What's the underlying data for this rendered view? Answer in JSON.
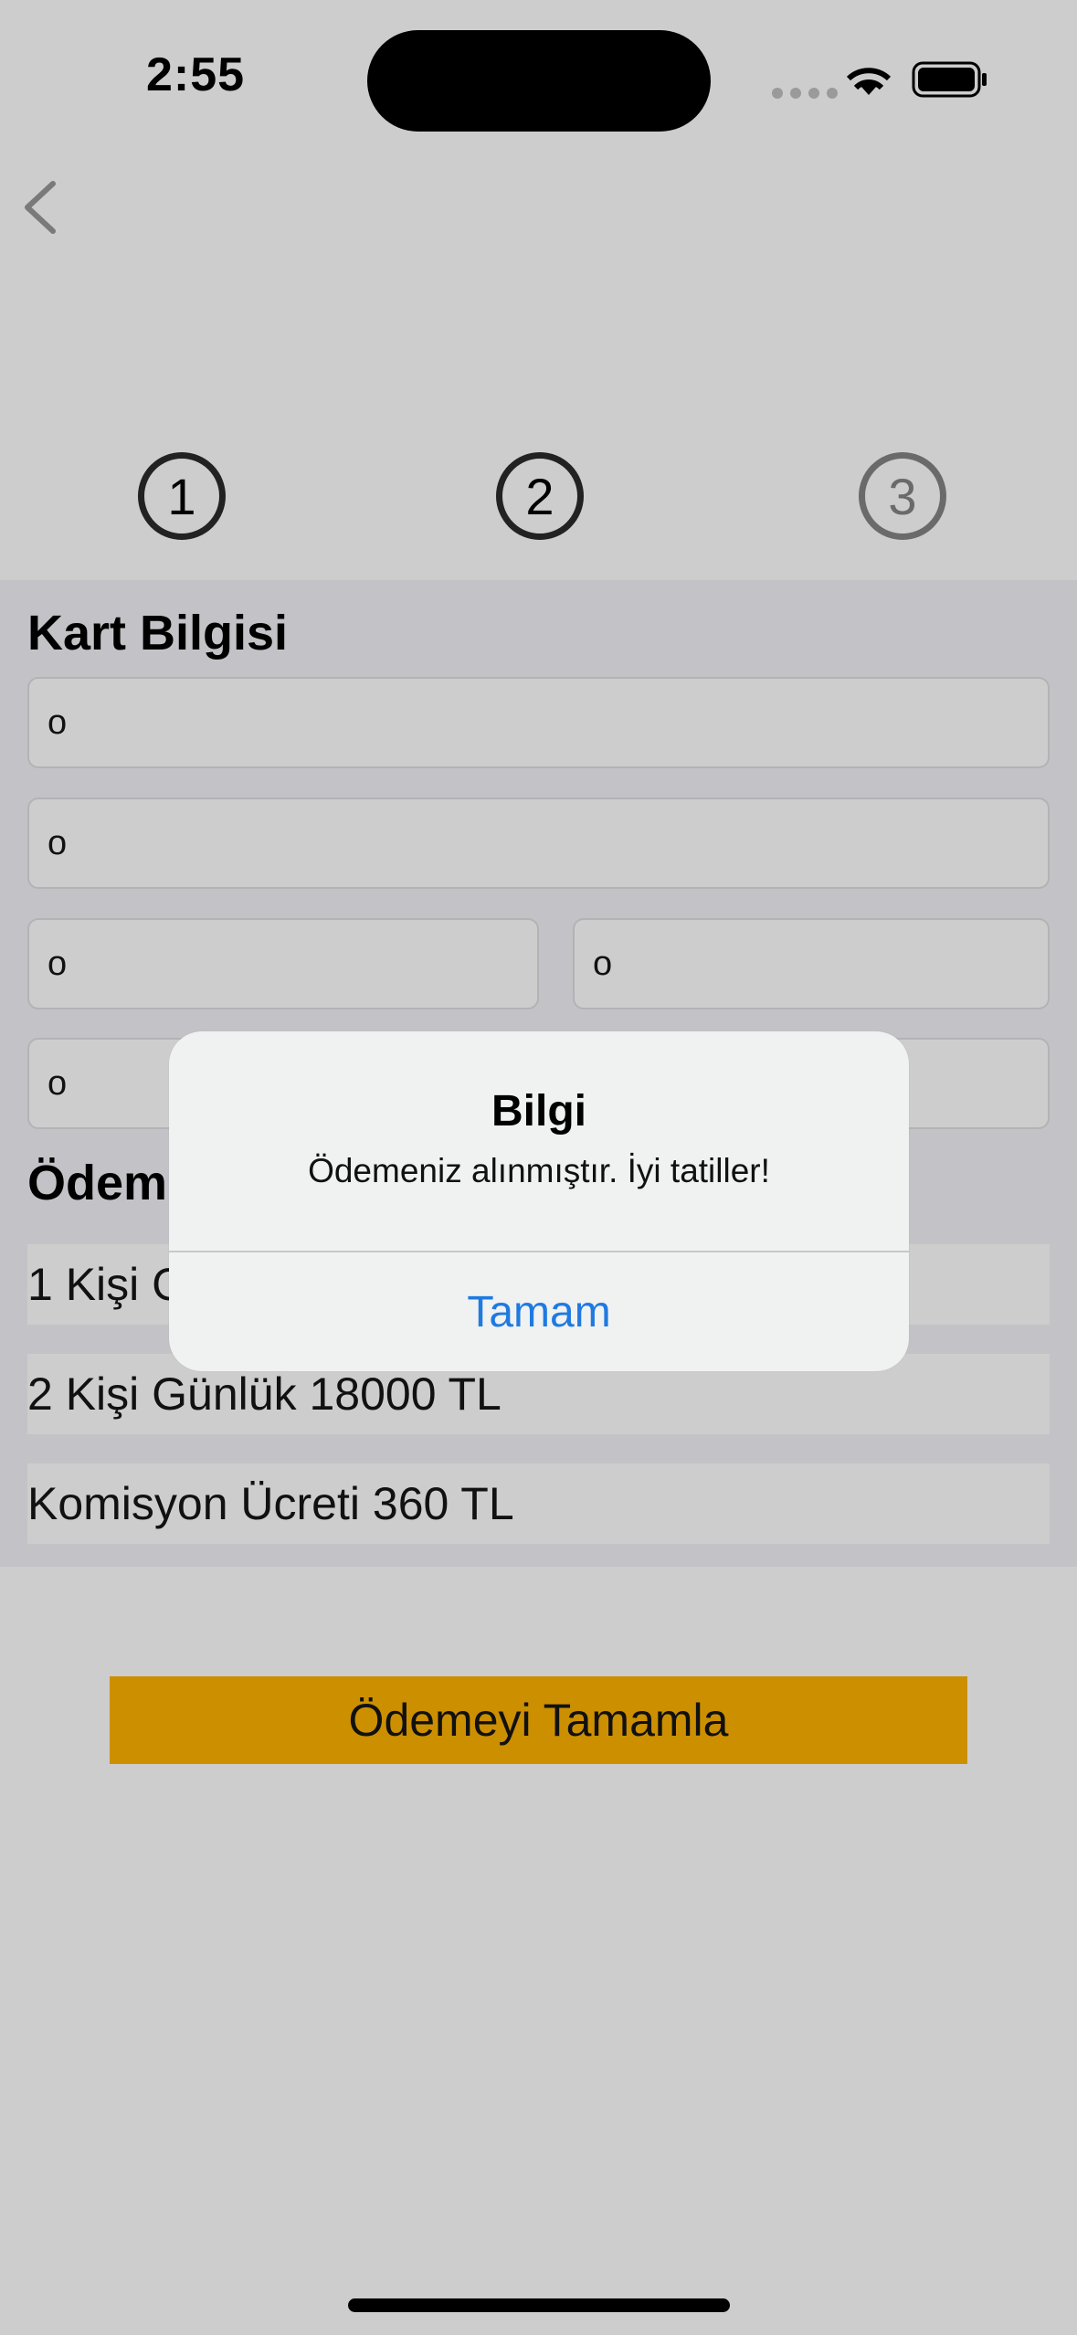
{
  "status_bar": {
    "time": "2:55",
    "icons": [
      "signal-icon",
      "wifi-icon",
      "battery-icon"
    ]
  },
  "nav": {
    "back_icon": "chevron-left-icon"
  },
  "steps": [
    "1",
    "2",
    "3"
  ],
  "card_section": {
    "title": "Kart Bilgisi",
    "fields": [
      "o",
      "o",
      "o",
      "o",
      "o",
      "o"
    ]
  },
  "payment_section": {
    "title": "Ödeme",
    "rows": [
      "1 Kişi Günlük",
      "2 Kişi Günlük 18000 TL",
      "Komisyon Ücreti 360 TL"
    ]
  },
  "primary_button": {
    "label": "Ödemeyi Tamamla",
    "color": "#cc8f00"
  },
  "alert": {
    "title": "Bilgi",
    "message": "Ödemeniz alınmıştır. İyi tatiller!",
    "button": "Tamam",
    "button_color": "#1f7ae0"
  }
}
